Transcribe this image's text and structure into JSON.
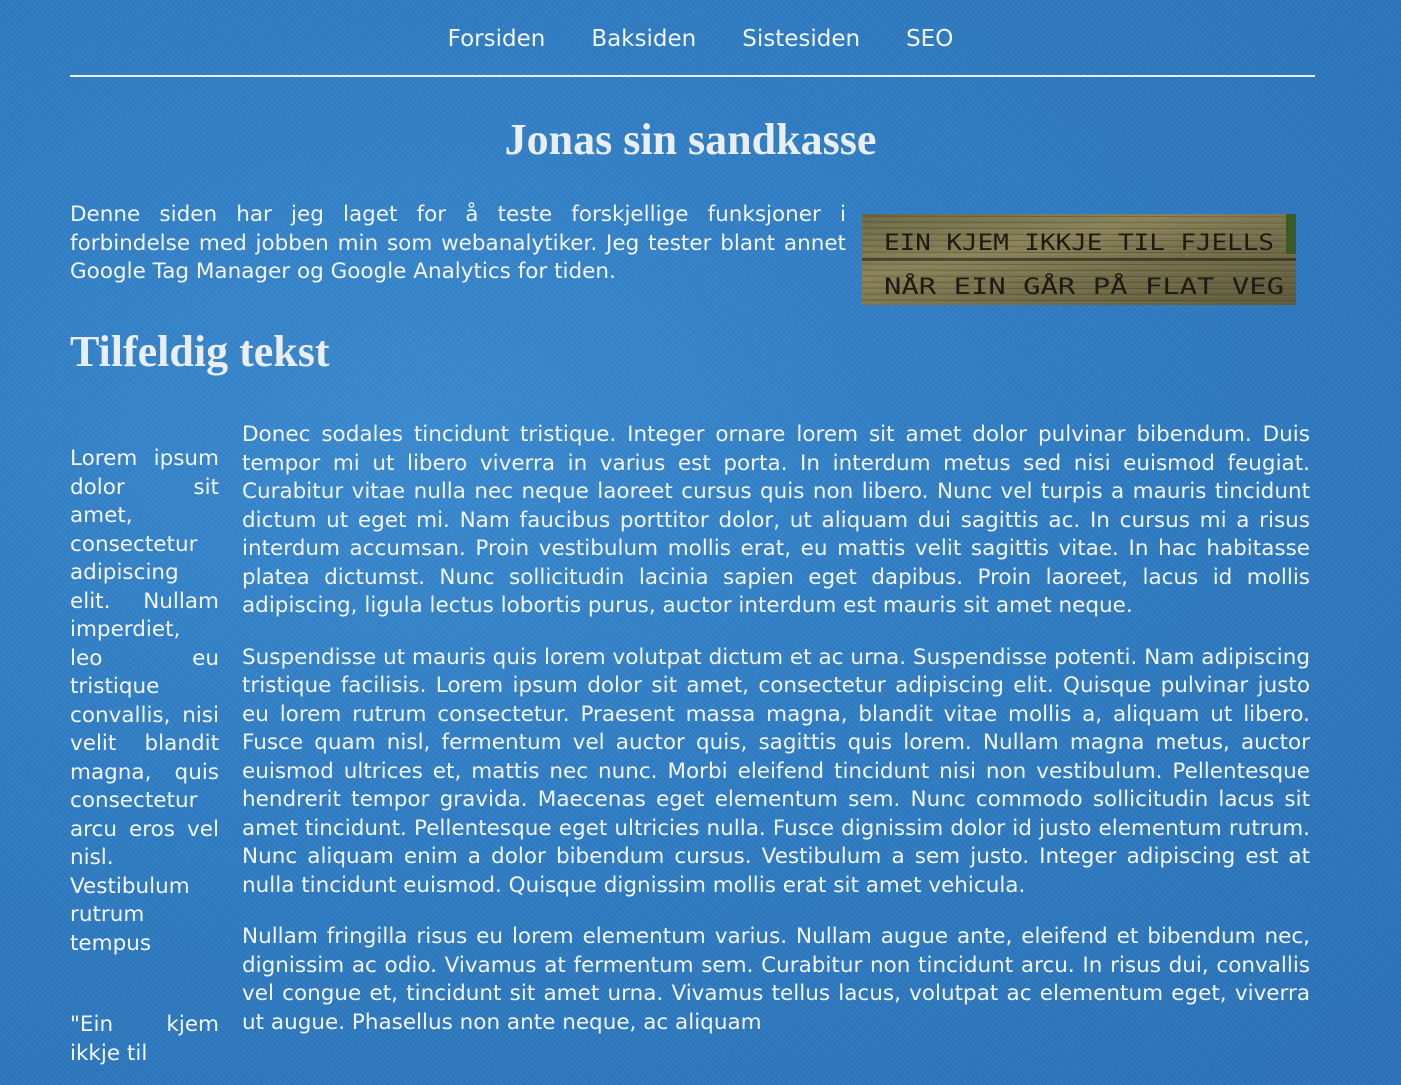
{
  "nav": {
    "items": [
      {
        "label": "Forsiden"
      },
      {
        "label": "Baksiden"
      },
      {
        "label": "Sistesiden"
      },
      {
        "label": "SEO"
      }
    ]
  },
  "header": {
    "title": "Jonas sin sandkasse"
  },
  "intro": {
    "text": "Denne siden har jeg laget for å teste forskjellige funksjoner i forbindelse med jobben min som webanalytiker. Jeg tester blant annet Google Tag Manager og Google Analytics for tiden."
  },
  "sign_image": {
    "line1": "EIN KJEM IKKJE TIL FJELLS",
    "line2": "NÅR EIN GÅR PÅ FLAT VEG"
  },
  "section": {
    "title": "Tilfeldig tekst"
  },
  "aside": {
    "text": "Lorem ipsum dolor sit amet, consectetur adipiscing elit. Nullam imperdiet, leo eu tristique convallis, nisi velit blandit magna, quis consectetur arcu eros vel nisl. Vestibulum rutrum tempus",
    "quote": "\"Ein kjem ikkje til"
  },
  "main": {
    "paragraphs": [
      "Donec sodales tincidunt tristique. Integer ornare lorem sit amet dolor pulvinar bibendum. Duis tempor mi ut libero viverra in varius est porta. In interdum metus sed nisi euismod feugiat. Curabitur vitae nulla nec neque laoreet cursus quis non libero. Nunc vel turpis a mauris tincidunt dictum ut eget mi. Nam faucibus porttitor dolor, ut aliquam dui sagittis ac. In cursus mi a risus interdum accumsan. Proin vestibulum mollis erat, eu mattis velit sagittis vitae. In hac habitasse platea dictumst. Nunc sollicitudin lacinia sapien eget dapibus. Proin laoreet, lacus id mollis adipiscing, ligula lectus lobortis purus, auctor interdum est mauris sit amet neque.",
      "Suspendisse ut mauris quis lorem volutpat dictum et ac urna. Suspendisse potenti. Nam adipiscing tristique facilisis. Lorem ipsum dolor sit amet, consectetur adipiscing elit. Quisque pulvinar justo eu lorem rutrum consectetur. Praesent massa magna, blandit vitae mollis a, aliquam ut libero. Fusce quam nisl, fermentum vel auctor quis, sagittis quis lorem. Nullam magna metus, auctor euismod ultrices et, mattis nec nunc. Morbi eleifend tincidunt nisi non vestibulum. Pellentesque hendrerit tempor gravida. Maecenas eget elementum sem. Nunc commodo sollicitudin lacus sit amet tincidunt. Pellentesque eget ultricies nulla. Fusce dignissim dolor id justo elementum rutrum. Nunc aliquam enim a dolor bibendum cursus. Vestibulum a sem justo. Integer adipiscing est at nulla tincidunt euismod. Quisque dignissim mollis erat sit amet vehicula.",
      "Nullam fringilla risus eu lorem elementum varius. Nullam augue ante, eleifend et bibendum nec, dignissim ac odio. Vivamus at fermentum sem. Curabitur non tincidunt arcu. In risus dui, convallis vel congue et, tincidunt sit amet urna. Vivamus tellus lacus, volutpat ac elementum eget, viverra ut augue. Phasellus non ante neque, ac aliquam"
    ]
  }
}
